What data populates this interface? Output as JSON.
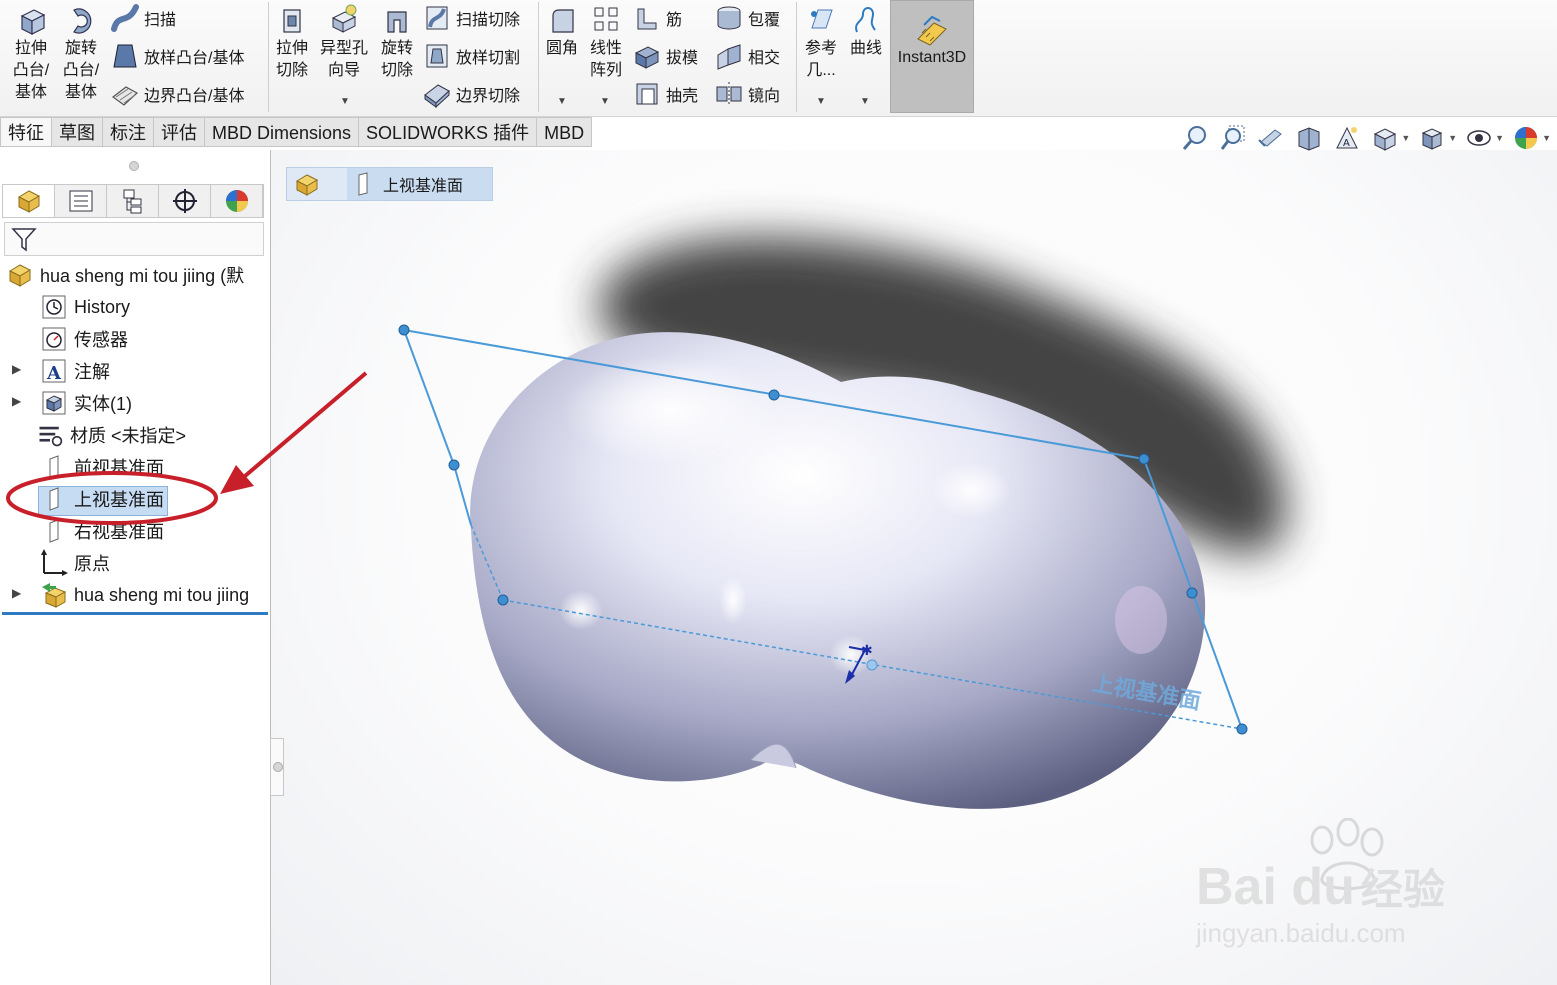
{
  "ribbon": {
    "extrude_boss": "拉伸\n凸台/\n基体",
    "revolve_boss": "旋转\n凸台/\n基体",
    "sweep": "扫描",
    "loft_boss": "放样凸台/基体",
    "boundary_boss": "边界凸台/基体",
    "extrude_cut": "拉伸\n切除",
    "hole_wizard": "异型孔\n向导",
    "revolve_cut": "旋转\n切除",
    "swept_cut": "扫描切除",
    "lofted_cut": "放样切割",
    "boundary_cut": "边界切除",
    "fillet": "圆角",
    "linear_pattern": "线性\n阵列",
    "rib": "筋",
    "draft": "拔模",
    "shell": "抽壳",
    "wrap": "包覆",
    "intersect": "相交",
    "mirror": "镜向",
    "reference_geometry": "参考\n几...",
    "curves": "曲线",
    "instant3d": "Instant3D"
  },
  "tabs": [
    "特征",
    "草图",
    "标注",
    "评估",
    "MBD Dimensions",
    "SOLIDWORKS 插件",
    "MBD"
  ],
  "tree": {
    "part_name": "hua sheng mi tou  jiing  (默",
    "history": "History",
    "sensors": "传感器",
    "annotations": "注解",
    "solid_bodies": "实体(1)",
    "material": "材质 <未指定>",
    "front_plane": "前视基准面",
    "top_plane": "上视基准面",
    "right_plane": "右视基准面",
    "origin": "原点",
    "feature": "hua sheng mi tou  jiing"
  },
  "breadcrumb": {
    "selected": "上视基准面"
  },
  "viewport": {
    "plane_label": "上视基准面"
  },
  "watermark": {
    "brand": "Bai  du",
    "brand_cn": "经验",
    "url": "jingyan.baidu.com"
  },
  "colors": {
    "selection_accent": "#2e7bc4",
    "annotation_red": "#c8202a",
    "plane_blue": "#4a9ad8"
  }
}
